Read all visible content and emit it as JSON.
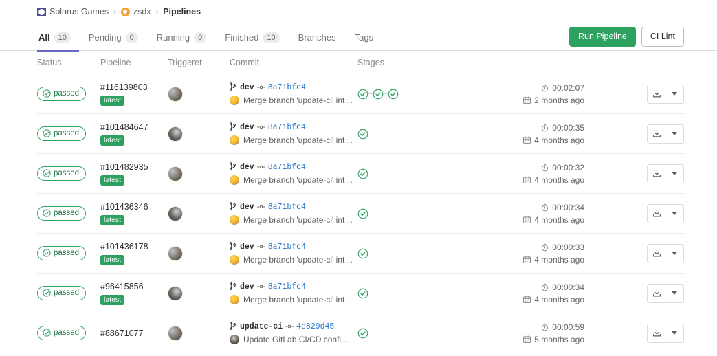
{
  "breadcrumb": {
    "group": "Solarus Games",
    "project": "zsdx",
    "current": "Pipelines",
    "separator": "›"
  },
  "tabs": [
    {
      "label": "All",
      "count": "10",
      "active": true
    },
    {
      "label": "Pending",
      "count": "0",
      "active": false
    },
    {
      "label": "Running",
      "count": "0",
      "active": false
    },
    {
      "label": "Finished",
      "count": "10",
      "active": false
    },
    {
      "label": "Branches",
      "count": "",
      "active": false
    },
    {
      "label": "Tags",
      "count": "",
      "active": false
    }
  ],
  "actions": {
    "run_pipeline": "Run Pipeline",
    "ci_lint": "CI Lint"
  },
  "columns": {
    "status": "Status",
    "pipeline": "Pipeline",
    "triggerer": "Triggerer",
    "commit": "Commit",
    "stages": "Stages"
  },
  "colors": {
    "success": "#2da160",
    "link": "#1f75cb",
    "accent": "#6666c4"
  },
  "rows": [
    {
      "status": "passed",
      "pipeline_id": "#116139803",
      "latest": "latest",
      "branch": "dev",
      "sha": "8a71bfc4",
      "message": "Merge branch 'update-ci' into 'd...",
      "stages": 3,
      "duration": "00:02:07",
      "age": "2 months ago"
    },
    {
      "status": "passed",
      "pipeline_id": "#101484647",
      "latest": "latest",
      "branch": "dev",
      "sha": "8a71bfc4",
      "message": "Merge branch 'update-ci' into 'd...",
      "stages": 1,
      "duration": "00:00:35",
      "age": "4 months ago"
    },
    {
      "status": "passed",
      "pipeline_id": "#101482935",
      "latest": "latest",
      "branch": "dev",
      "sha": "8a71bfc4",
      "message": "Merge branch 'update-ci' into 'd...",
      "stages": 1,
      "duration": "00:00:32",
      "age": "4 months ago"
    },
    {
      "status": "passed",
      "pipeline_id": "#101436346",
      "latest": "latest",
      "branch": "dev",
      "sha": "8a71bfc4",
      "message": "Merge branch 'update-ci' into 'd...",
      "stages": 1,
      "duration": "00:00:34",
      "age": "4 months ago"
    },
    {
      "status": "passed",
      "pipeline_id": "#101436178",
      "latest": "latest",
      "branch": "dev",
      "sha": "8a71bfc4",
      "message": "Merge branch 'update-ci' into 'd...",
      "stages": 1,
      "duration": "00:00:33",
      "age": "4 months ago"
    },
    {
      "status": "passed",
      "pipeline_id": "#96415856",
      "latest": "latest",
      "branch": "dev",
      "sha": "8a71bfc4",
      "message": "Merge branch 'update-ci' into 'd...",
      "stages": 1,
      "duration": "00:00:34",
      "age": "4 months ago"
    },
    {
      "status": "passed",
      "pipeline_id": "#88671077",
      "latest": "",
      "branch": "update-ci",
      "sha": "4e829d45",
      "message": "Update GitLab CI/CD configurati...",
      "stages": 1,
      "duration": "00:00:59",
      "age": "5 months ago"
    }
  ]
}
